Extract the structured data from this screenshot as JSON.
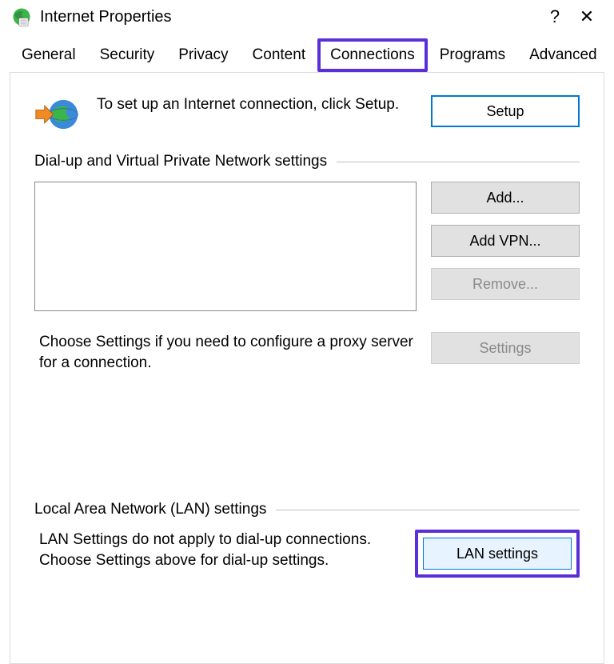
{
  "window": {
    "title": "Internet Properties",
    "help_symbol": "?",
    "close_symbol": "✕"
  },
  "tabs": {
    "items": [
      "General",
      "Security",
      "Privacy",
      "Content",
      "Connections",
      "Programs",
      "Advanced"
    ],
    "active_index": 4
  },
  "setup": {
    "text": "To set up an Internet connection, click Setup.",
    "button": "Setup"
  },
  "groups": {
    "dialup_label": "Dial-up and Virtual Private Network settings",
    "lan_label": "Local Area Network (LAN) settings"
  },
  "dialup_buttons": {
    "add": "Add...",
    "add_vpn": "Add VPN...",
    "remove": "Remove...",
    "settings": "Settings"
  },
  "proxy_text": "Choose Settings if you need to configure a proxy server for a connection.",
  "lan": {
    "text": "LAN Settings do not apply to dial-up connections. Choose Settings above for dial-up settings.",
    "button": "LAN settings"
  },
  "highlights": {
    "tab_highlighted": true,
    "lan_highlighted": true
  }
}
